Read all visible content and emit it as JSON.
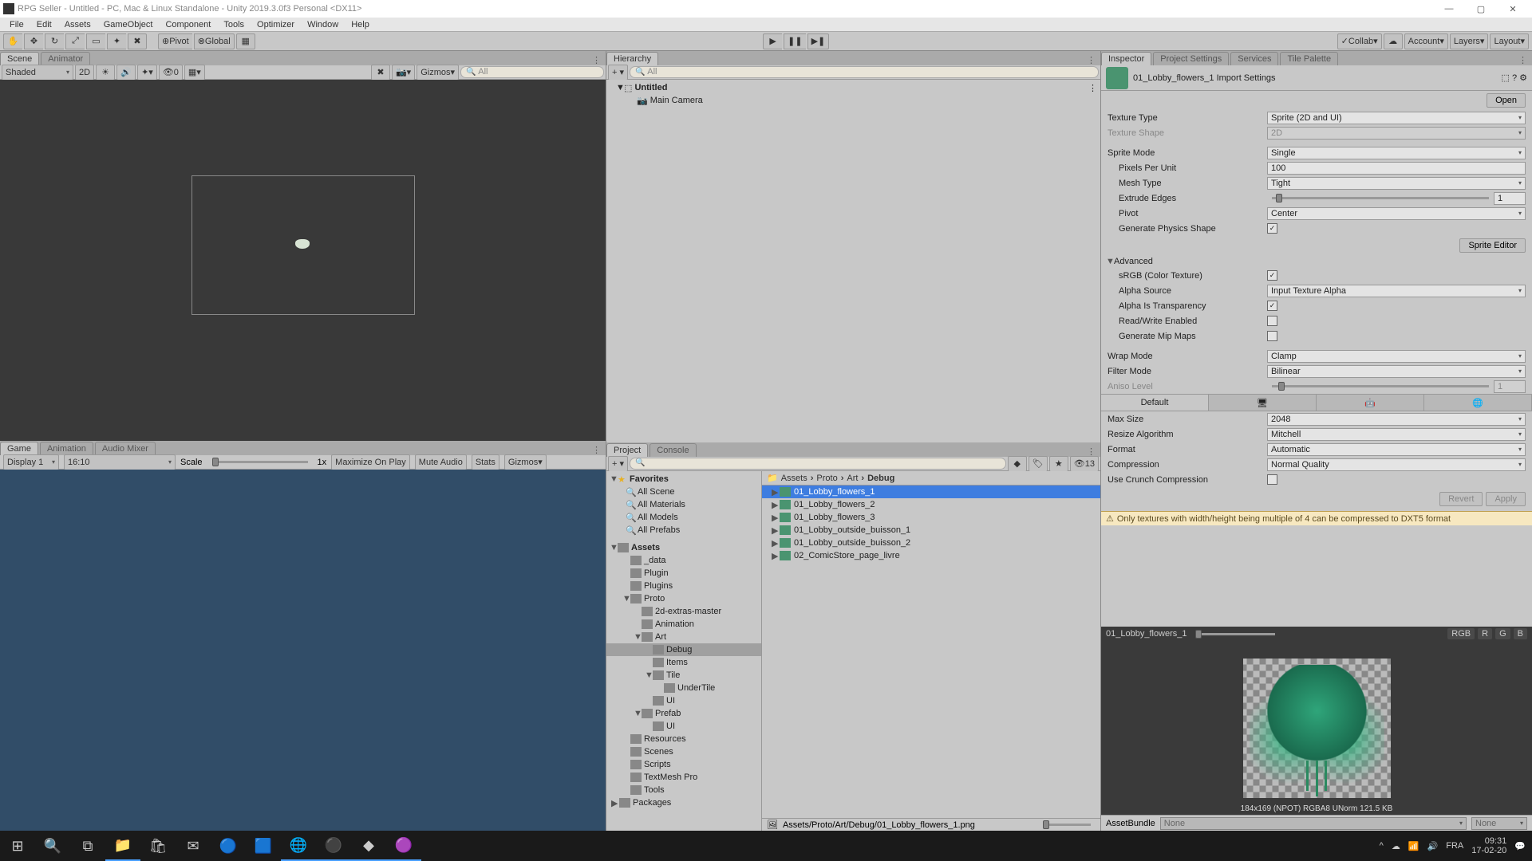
{
  "title": "RPG Seller - Untitled - PC, Mac & Linux Standalone - Unity 2019.3.0f3 Personal <DX11>",
  "menubar": [
    "File",
    "Edit",
    "Assets",
    "GameObject",
    "Component",
    "Tools",
    "Optimizer",
    "Window",
    "Help"
  ],
  "toolbar": {
    "pivot": "Pivot",
    "global": "Global",
    "collab": "Collab",
    "account": "Account",
    "layers": "Layers",
    "layout": "Layout"
  },
  "scene": {
    "tabs": [
      "Scene",
      "Animator"
    ],
    "shading": "Shaded",
    "mode2d": "2D",
    "axis_count": "0",
    "gizmos": "Gizmos",
    "search_ph": "All"
  },
  "game": {
    "tabs": [
      "Game",
      "Animation",
      "Audio Mixer"
    ],
    "display": "Display 1",
    "aspect": "16:10",
    "scale_label": "Scale",
    "scale_val": "1x",
    "maximize": "Maximize On Play",
    "mute": "Mute Audio",
    "stats": "Stats",
    "gizmos": "Gizmos"
  },
  "hierarchy": {
    "tab": "Hierarchy",
    "search_ph": "All",
    "scene_name": "Untitled",
    "items": [
      "Main Camera"
    ]
  },
  "project": {
    "tabs": [
      "Project",
      "Console"
    ],
    "hidden_count": "13",
    "favorites_label": "Favorites",
    "favorites": [
      "All Scene",
      "All Materials",
      "All Models",
      "All Prefabs"
    ],
    "assets_label": "Assets",
    "tree": [
      {
        "name": "_data",
        "depth": 1
      },
      {
        "name": "Plugin",
        "depth": 1
      },
      {
        "name": "Plugins",
        "depth": 1
      },
      {
        "name": "Proto",
        "depth": 1,
        "open": true
      },
      {
        "name": "2d-extras-master",
        "depth": 2
      },
      {
        "name": "Animation",
        "depth": 2
      },
      {
        "name": "Art",
        "depth": 2,
        "open": true
      },
      {
        "name": "Debug",
        "depth": 3,
        "sel": true
      },
      {
        "name": "Items",
        "depth": 3
      },
      {
        "name": "Tile",
        "depth": 3,
        "open": true
      },
      {
        "name": "UnderTile",
        "depth": 4
      },
      {
        "name": "UI",
        "depth": 3
      },
      {
        "name": "Prefab",
        "depth": 2,
        "open": true
      },
      {
        "name": "UI",
        "depth": 3
      },
      {
        "name": "Resources",
        "depth": 1
      },
      {
        "name": "Scenes",
        "depth": 1
      },
      {
        "name": "Scripts",
        "depth": 1
      },
      {
        "name": "TextMesh Pro",
        "depth": 1
      },
      {
        "name": "Tools",
        "depth": 1
      },
      {
        "name": "Packages",
        "depth": 0,
        "foldclosed": true
      }
    ],
    "breadcrumb": [
      "Assets",
      "Proto",
      "Art",
      "Debug"
    ],
    "files": [
      {
        "name": "01_Lobby_flowers_1",
        "sel": true
      },
      {
        "name": "01_Lobby_flowers_2"
      },
      {
        "name": "01_Lobby_flowers_3"
      },
      {
        "name": "01_Lobby_outside_buisson_1"
      },
      {
        "name": "01_Lobby_outside_buisson_2"
      },
      {
        "name": "02_ComicStore_page_livre"
      }
    ],
    "path": "Assets/Proto/Art/Debug/01_Lobby_flowers_1.png"
  },
  "inspector": {
    "tabs": [
      "Inspector",
      "Project Settings",
      "Services",
      "Tile Palette"
    ],
    "asset_name": "01_Lobby_flowers_1 Import Settings",
    "open": "Open",
    "fields": {
      "texture_type": {
        "label": "Texture Type",
        "value": "Sprite (2D and UI)"
      },
      "texture_shape": {
        "label": "Texture Shape",
        "value": "2D",
        "disabled": true
      },
      "sprite_mode": {
        "label": "Sprite Mode",
        "value": "Single"
      },
      "pixels_per_unit": {
        "label": "Pixels Per Unit",
        "value": "100"
      },
      "mesh_type": {
        "label": "Mesh Type",
        "value": "Tight"
      },
      "extrude_edges": {
        "label": "Extrude Edges",
        "value": "1"
      },
      "pivot": {
        "label": "Pivot",
        "value": "Center"
      },
      "gen_physics": {
        "label": "Generate Physics Shape",
        "checked": true
      },
      "sprite_editor": "Sprite Editor",
      "advanced": "Advanced",
      "srgb": {
        "label": "sRGB (Color Texture)",
        "checked": true
      },
      "alpha_source": {
        "label": "Alpha Source",
        "value": "Input Texture Alpha"
      },
      "alpha_transparency": {
        "label": "Alpha Is Transparency",
        "checked": true
      },
      "read_write": {
        "label": "Read/Write Enabled",
        "checked": false
      },
      "mipmaps": {
        "label": "Generate Mip Maps",
        "checked": false
      },
      "wrap_mode": {
        "label": "Wrap Mode",
        "value": "Clamp"
      },
      "filter_mode": {
        "label": "Filter Mode",
        "value": "Bilinear"
      },
      "aniso": {
        "label": "Aniso Level",
        "value": "1",
        "disabled": true
      },
      "default_tab": "Default",
      "max_size": {
        "label": "Max Size",
        "value": "2048"
      },
      "resize_algo": {
        "label": "Resize Algorithm",
        "value": "Mitchell"
      },
      "format": {
        "label": "Format",
        "value": "Automatic"
      },
      "compression": {
        "label": "Compression",
        "value": "Normal Quality"
      },
      "crunch": {
        "label": "Use Crunch Compression",
        "checked": false
      },
      "revert": "Revert",
      "apply": "Apply",
      "warning": "Only textures with width/height being multiple of 4 can be compressed to DXT5 format"
    },
    "preview": {
      "name": "01_Lobby_flowers_1",
      "channels": [
        "RGB",
        "R",
        "G",
        "B"
      ],
      "info": "184x169 (NPOT)  RGBA8 UNorm  121.5 KB"
    },
    "assetbundle": {
      "label": "AssetBundle",
      "value": "None",
      "variant": "None"
    }
  },
  "taskbar": {
    "time": "09:31",
    "date": "17-02-20",
    "lang": "FRA"
  }
}
